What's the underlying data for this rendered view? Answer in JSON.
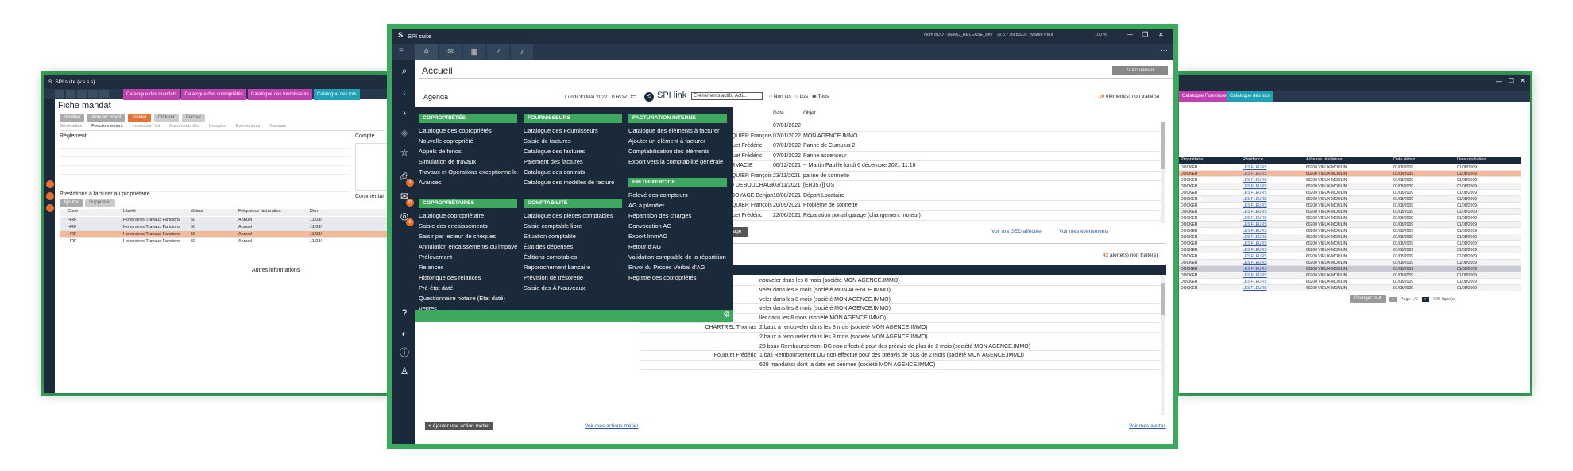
{
  "colors": {
    "green_frame": "#3aaa5c",
    "navy": "#1b2a3b",
    "accent_green": "#3fa85f",
    "orange": "#e8712f",
    "teal": "#20a0b5",
    "blue": "#1c74c9",
    "pink_row": "#f4b89a"
  },
  "center": {
    "app_title": "SPI suite",
    "user_info": "Nom BDD : DEMO_RELEASE_dev    (V.5.7.99.8322)   Martin Paul",
    "zoom": "100 %",
    "page_title": "Accueil",
    "refresh_label": "Actualiser",
    "agenda": {
      "title": "Agenda",
      "date": "Lundi 30 Mai 2022",
      "rdv": "0 RDV",
      "add_action": "+ Ajouter une action métier",
      "see_actions": "Voir mes actions métier"
    },
    "spilink": {
      "title": "SPI link",
      "filter": "Événements actifs, Acti...",
      "radio_non_lus": "Non lus",
      "radio_lus": "Lus",
      "radio_tous": "Tous",
      "unread_count": "10",
      "unread_label": "élément(s) non traité(s)",
      "headers": [
        "Tiers",
        "Date",
        "Objet"
      ],
      "rows": [
        [
          "",
          "07/01/2022",
          ""
        ],
        [
          "FOUQUIER François",
          "07/01/2022",
          "MON AGENCE.IMMO"
        ],
        [
          "Fouquet Frédéric",
          "07/01/2022",
          "Panne de Cumulus 2"
        ],
        [
          "Fouquet Frédéric",
          "07/01/2022",
          "Panne ascenseur"
        ],
        [
          "PHARMACIE",
          "06/12/2021",
          "-- Martin Paul le lundi 6 décembre 2021 11:16 :"
        ],
        [
          "FOUQUIER François",
          "23/11/2021",
          "panne de sonnette"
        ],
        [
          "ALLO DEBOUCHAGE",
          "03/11/2021",
          "[ER357]] OS"
        ],
        [
          "LLE BOYAGE Benjamin",
          "18/08/2021",
          "Départ Locataire"
        ],
        [
          "FOUQUIER François",
          "20/09/2021",
          "Problème de sonnette"
        ],
        [
          "Fouquet Frédéric",
          "22/06/2021",
          "Réparation portail garage (changement moteur)"
        ]
      ],
      "link_ged": "Voir ma GED affectée",
      "link_events": "Voir mes événements",
      "message_btn": "message"
    },
    "alerts": {
      "count": "42",
      "label": "alerte(s) non traité(s)",
      "rows": [
        [
          "",
          "nouveler dans les 8 mois (société MON AGENCE.IMMO)"
        ],
        [
          "",
          "veler dans les 8 mois (société MON AGENCE.IMMO)"
        ],
        [
          "",
          "veler dans les 8 mois (société MON AGENCE.IMMO)"
        ],
        [
          "",
          "veler dans les 8 mois (société MON AGENCE.IMMO)"
        ],
        [
          "",
          "ller dans les 8 mois (société MON AGENCE.IMMO)"
        ],
        [
          "CHARTREL Thomas",
          "2 baux à renouveler dans les 8 mois (société MON AGENCE.IMMO)"
        ],
        [
          "",
          "2 baux à renouveler dans les 8 mois (société MON AGENCE.IMMO)"
        ],
        [
          "",
          "28 baux Remboursement DG non effectué pour des préavis de plus de 2 mois (société MON AGENCE.IMMO)"
        ],
        [
          "Fouquet Frédéric",
          "1 bail Remboursement DG non effectué pour des préavis de plus de 2 mois (société MON AGENCE.IMMO)"
        ],
        [
          "",
          "629 mandat(s) dont la date est périmée (société MON AGENCE.IMMO)"
        ]
      ],
      "see_alerts": "Voir mes alertes"
    },
    "menu": {
      "col1": [
        {
          "header": "COPROPRIÉTÉS",
          "items": [
            "Catalogue des copropriétés",
            "Nouvelle copropriété",
            "Appels de fonds",
            "Simulation de travaux",
            "Travaux et Opérations exceptionnelles",
            "Avances"
          ]
        },
        {
          "header": "COPROPRIÉTAIRES",
          "items": [
            "Catalogue copropriétaire",
            "Saisie des encaissements",
            "Saisir par lecteur de chèques",
            "Annulation encaissements ou impayés",
            "Prélèvement",
            "Relances",
            "Historique des relances",
            "Pré-état daté",
            "Questionnaire notaire (État daté)",
            "Ventes"
          ]
        }
      ],
      "col2": [
        {
          "header": "FOURNISSEURS",
          "items": [
            "Catalogue des Fournisseurs",
            "Saisie de factures",
            "Catalogue des factures",
            "Paiement des factures",
            "Catalogue des contrats",
            "Catalogue des modèles de facture"
          ]
        },
        {
          "header": "COMPTABILITÉ",
          "items": [
            "Catalogue des pièces comptables",
            "Saisie comptable libre",
            "Situation comptable",
            "État des dépenses",
            "Éditions comptables",
            "Rapprochement bancaire",
            "Prévision de trésorerie",
            "Saisie des À Nouveaux"
          ]
        }
      ],
      "col3": [
        {
          "header": "FACTURATION INTERNE",
          "items": [
            "Catalogue des éléments à facturer",
            "Ajouter un élément à facturer",
            "Comptabilisation des éléments",
            "Export vers la comptabilité générale"
          ]
        },
        {
          "header": "FIN D'EXERCICE",
          "items": [
            "Relevé des compteurs",
            "AG à planifier",
            "Répartition des charges",
            "Convocation AG",
            "Export ImmAG",
            "Retour d'AG",
            "Validation comptable de la répartition",
            "Envoi du Procès Verbal d'AG",
            "Registre des copropriétés"
          ]
        }
      ]
    },
    "sidebar_badges": [
      "3",
      "32",
      "9"
    ]
  },
  "left": {
    "app_title": "SPI suite (v.s.s.s)",
    "tabs": [
      "Catalogue des mandats",
      "Catalogue des copropriétés",
      "Catalogue des fournisseurs",
      "Catalogue des lots"
    ],
    "page_title": "Fiche mandat",
    "actions": [
      "Modifier",
      "Annuler modif",
      "Valider",
      "Clôturer",
      "Fermer"
    ],
    "subtabs": [
      "Généralités",
      "Fonctionnement",
      "Immeuble / lot",
      "Documents liés",
      "Comptes",
      "Evénements",
      "Contrats"
    ],
    "section_reglement": "Règlement",
    "section_compte": "Compte",
    "section_prestations": "Prestations à facturer au propriétaire",
    "prest_buttons": [
      "Ajouter",
      "Supprimer"
    ],
    "prest_headers": [
      "Code",
      "Libellé",
      "Valeur",
      "Fréquence facturation",
      "Dern"
    ],
    "prest_rows": [
      [
        "HRF",
        "Honoraires Travaux Fancions",
        "50",
        "Annuel",
        "11/03/"
      ],
      [
        "HRF",
        "Honoraires Travaux Fancions",
        "50",
        "Annuel",
        "11/03/"
      ],
      [
        "HRF",
        "Honoraires Travaux Fancions",
        "50",
        "Annuel",
        "11/03/"
      ],
      [
        "HRF",
        "Honoraires Travaux Fancions",
        "50",
        "Annuel",
        "11/03/"
      ]
    ],
    "autres_info": "Autres informations",
    "commentaire": "Commentai"
  },
  "right": {
    "headers": [
      "Propriétaire",
      "Résidence",
      "Adresse résidence",
      "Date début",
      "Date résiliation"
    ],
    "row_owner": "DOCKER",
    "row_res": "LES FLEURS",
    "row_addr": "60200 VIEUX-MOULIN",
    "row_d1": "01/08/2009",
    "row_d2": "01/08/2009",
    "tabs": [
      "Catalogue Fournisseurs",
      "Catalogue des lots"
    ],
    "footer_btn": "Changer tout",
    "page_info": "Page 1/6",
    "total": "406 ligne(s)"
  }
}
